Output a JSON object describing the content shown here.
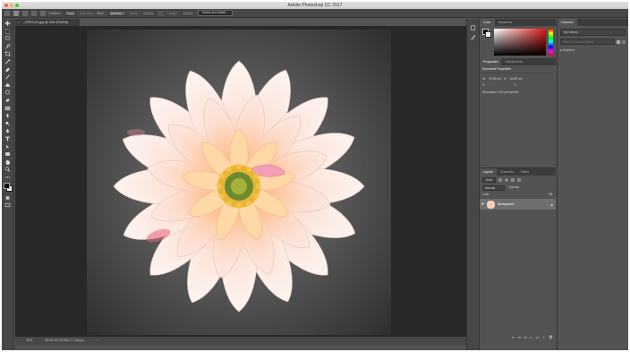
{
  "window": {
    "title": "Adobe Photoshop CC 2017"
  },
  "options_bar": {
    "feather_label": "Feather:",
    "feather_value": "0 px",
    "antialias_label": "Anti-alias",
    "style_label": "Style:",
    "style_value": "Normal",
    "width_label": "Width:",
    "height_label": "Height:",
    "select_mask_label": "Select and Mask..."
  },
  "document": {
    "tab_label": "_DSF2124.jpg @ 33% (RGB/8)"
  },
  "status_bar": {
    "zoom": "33%",
    "doc_profile": "sRGB IEC61966-2.1 (8bpc)"
  },
  "color_panel": {
    "tabs": [
      "Color",
      "Swatches"
    ]
  },
  "properties_panel": {
    "tabs": [
      "Properties",
      "Adjustments"
    ],
    "section_title": "Document Properties",
    "w_label": "W:",
    "w_value": "33.86 cm",
    "h_label": "H:",
    "h_value": "33.85 cm",
    "x_label": "X:",
    "y_label": "Y:",
    "resolution": "Resolution: 240 pixels/inch"
  },
  "layers_panel": {
    "tabs": [
      "Layers",
      "Channels",
      "Paths"
    ],
    "kind_label": "Kind",
    "blend_mode": "Normal",
    "opacity_label": "Opacity:",
    "lock_label": "Lock:",
    "fill_label": "Fill:",
    "layer_name": "Background"
  },
  "libraries_panel": {
    "tab": "Libraries",
    "library_name": "My Library",
    "search_placeholder": "Search Current Library",
    "section": "Graphics"
  },
  "colors": {
    "accent": "#2e6fcc",
    "panel_bg": "#535353",
    "canvas_bg": "#282828"
  }
}
